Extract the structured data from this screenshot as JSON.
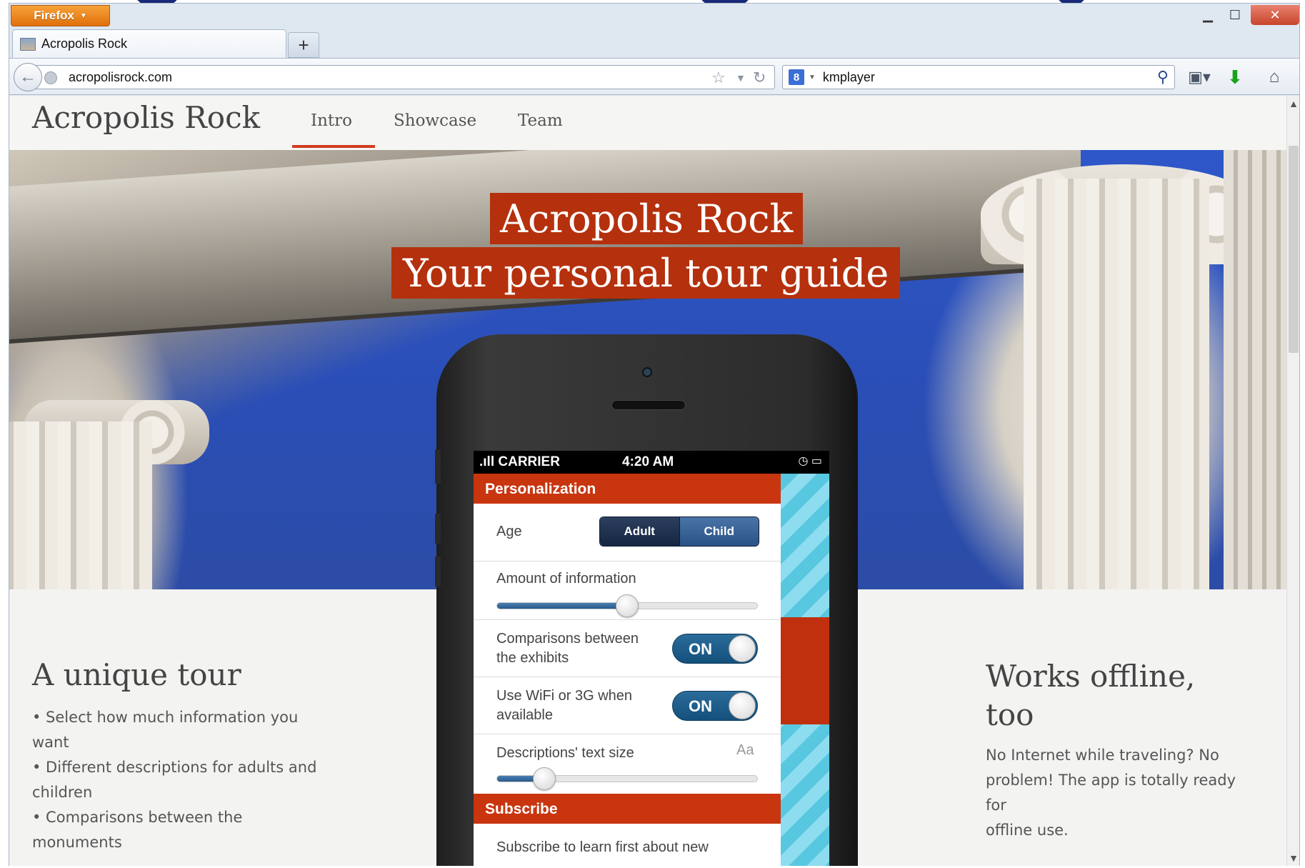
{
  "browser": {
    "menu_button": "Firefox",
    "tab_title": "Acropolis Rock",
    "url": "acropolisrock.com",
    "search_query": "kmplayer",
    "search_engine_glyph": "8"
  },
  "site": {
    "logo": "Acropolis Rock",
    "nav": [
      "Intro",
      "Showcase",
      "Team"
    ],
    "active_nav": "Intro"
  },
  "hero": {
    "title_line1": "Acropolis Rock",
    "title_line2": "Your personal tour guide"
  },
  "phone": {
    "carrier": ".ıll CARRIER",
    "time": "4:20 AM",
    "personalization_header": "Personalization",
    "age_label": "Age",
    "age_options": [
      "Adult",
      "Child"
    ],
    "age_selected": "Adult",
    "amount_label": "Amount of information",
    "amount_level": 0.5,
    "comparisons_label_1": "Comparisons between",
    "comparisons_label_2": "the exhibits",
    "comparisons_toggle": "ON",
    "wifi_label_1": "Use WiFi or 3G when",
    "wifi_label_2": "available",
    "wifi_toggle": "ON",
    "text_size_label": "Descriptions' text size",
    "text_size_icon_text": "Aa",
    "text_size_level": 0.18,
    "subscribe_header": "Subscribe",
    "subscribe_text": "Subscribe to learn first about new"
  },
  "left_section": {
    "heading": "A unique tour",
    "bullets": [
      "• Select how much information you",
      "want",
      "• Different descriptions for adults and",
      "children",
      "• Comparisons between the",
      "monuments"
    ]
  },
  "right_section": {
    "heading_1": "Works offline,",
    "heading_2": "too",
    "body_1": "No Internet while traveling? No",
    "body_2": "problem! The app is totally ready for",
    "body_3": "offline use."
  },
  "colors": {
    "accent": "#b5300d",
    "nav_underline": "#d23a1e",
    "firefox_orange": "#e8800f"
  }
}
